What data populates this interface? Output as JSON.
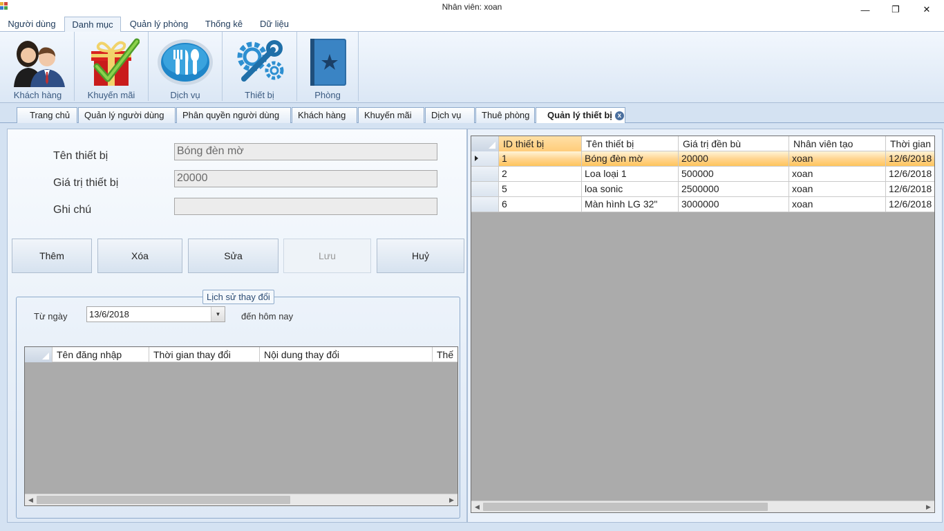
{
  "window": {
    "title": "Nhân viên: xoan",
    "minimize": "—",
    "maximize": "❐",
    "close": "✕"
  },
  "ribbon_tabs": [
    "Người dùng",
    "Danh mục",
    "Quản lý phòng",
    "Thống kê",
    "Dữ liệu"
  ],
  "ribbon_groups": [
    {
      "label": "Khách hàng",
      "icon": "customers-icon"
    },
    {
      "label": "Khuyến mãi",
      "icon": "gift-check-icon"
    },
    {
      "label": "Dịch vụ",
      "icon": "dining-service-icon"
    },
    {
      "label": "Thiết bị",
      "icon": "gear-wrench-icon"
    },
    {
      "label": "Phòng",
      "icon": "star-book-icon"
    }
  ],
  "doc_tabs": [
    "Trang chủ",
    "Quản lý người dùng",
    "Phân quyền người dùng",
    "Khách hàng",
    "Khuyến mãi",
    "Dịch vụ",
    "Thuê phòng",
    "Quản lý thiết bị"
  ],
  "active_doc_tab_close": "x",
  "form": {
    "name_label": "Tên thiết bị",
    "name_value": "Bóng đèn mờ",
    "value_label": "Giá trị thiết bị",
    "value_value": "20000",
    "note_label": "Ghi chú",
    "note_value": ""
  },
  "buttons": {
    "add": "Thêm",
    "delete": "Xóa",
    "edit": "Sửa",
    "save": "Lưu",
    "cancel": "Huỷ"
  },
  "history": {
    "legend": "Lịch sử thay đổi",
    "from_label": "Từ ngày",
    "from_date": "13/6/2018",
    "to_label": "đến hôm nay",
    "columns": [
      "Tên đăng nhập",
      "Thời gian thay đổi",
      "Nội dung thay đổi",
      "Thế"
    ]
  },
  "device_grid": {
    "columns": [
      "ID thiết bị",
      "Tên thiết bị",
      "Giá trị đền bù",
      "Nhân viên tạo",
      "Thời gian"
    ],
    "rows": [
      [
        "1",
        "Bóng đèn mờ",
        "20000",
        "xoan",
        "12/6/2018"
      ],
      [
        "2",
        "Loa loại 1",
        "500000",
        "xoan",
        "12/6/2018"
      ],
      [
        "5",
        "loa sonic",
        "2500000",
        "xoan",
        "12/6/2018"
      ],
      [
        "6",
        "Màn hình LG 32\"",
        "3000000",
        "xoan",
        "12/6/2018"
      ]
    ],
    "selected_row": 0
  },
  "scroll": {
    "left": "◀",
    "right": "▶",
    "grip": "|||"
  }
}
